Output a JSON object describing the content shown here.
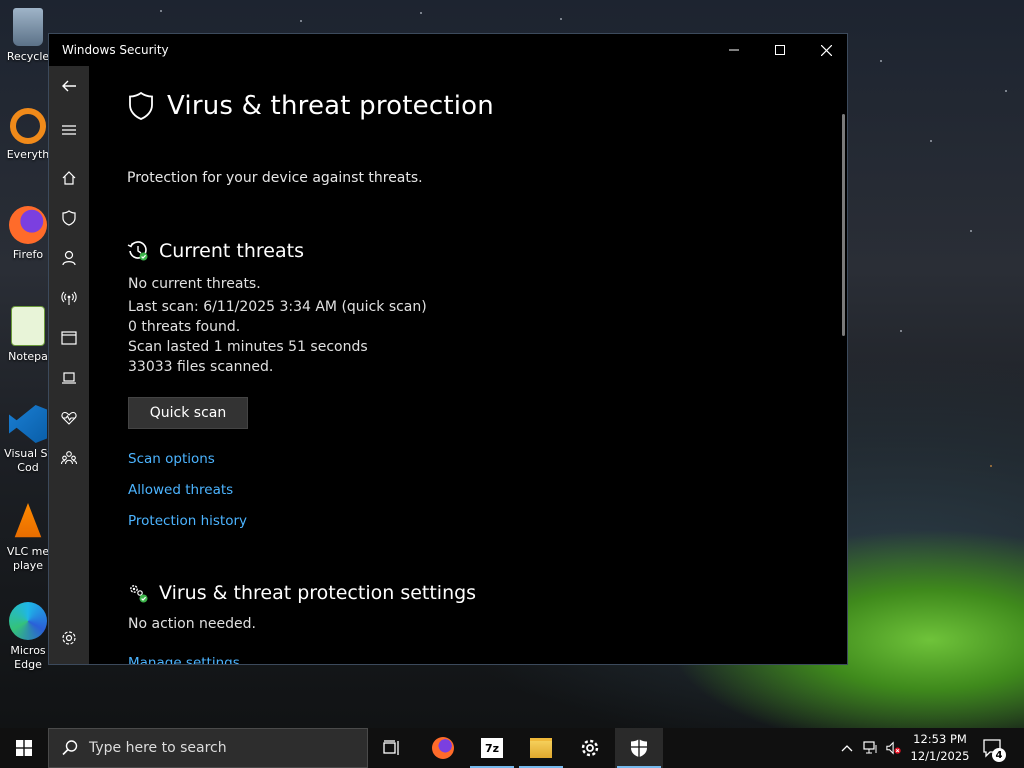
{
  "desktop": {
    "icons": [
      {
        "label": "Recycle"
      },
      {
        "label": "Everyth"
      },
      {
        "label": "Firefo"
      },
      {
        "label": "Notepa"
      },
      {
        "label": "Visual St\nCod"
      },
      {
        "label": "VLC me\nplaye"
      },
      {
        "label": "Micros\nEdge"
      }
    ]
  },
  "window": {
    "title": "Windows Security",
    "controls": {
      "minimize": "—",
      "maximize": "☐",
      "close": "✕"
    }
  },
  "nav": {
    "items": [
      "back-icon",
      "menu-icon",
      "home-icon",
      "shield-icon",
      "person-icon",
      "network-icon",
      "app-browser-icon",
      "device-icon",
      "health-icon",
      "family-icon",
      "settings-icon"
    ]
  },
  "page": {
    "title": "Virus & threat protection",
    "subtitle": "Protection for your device against threats."
  },
  "current_threats": {
    "title": "Current threats",
    "lines": [
      "No current threats.",
      "Last scan: 6/11/2025 3:34 AM (quick scan)",
      "0 threats found.",
      "Scan lasted 1 minutes 51 seconds",
      "33033 files scanned."
    ],
    "quick_scan_label": "Quick scan",
    "links": [
      "Scan options",
      "Allowed threats",
      "Protection history"
    ]
  },
  "settings_section": {
    "title": "Virus & threat protection settings",
    "status": "No action needed.",
    "link": "Manage settings"
  },
  "taskbar": {
    "search_placeholder": "Type here to search",
    "time": "12:53 PM",
    "date": "12/1/2025",
    "notifications": "4"
  },
  "colors": {
    "accent_link": "#4cb4ff",
    "window_bg": "#000000",
    "nav_bg": "#2b2b2b",
    "status_ok": "#3cb44a"
  }
}
